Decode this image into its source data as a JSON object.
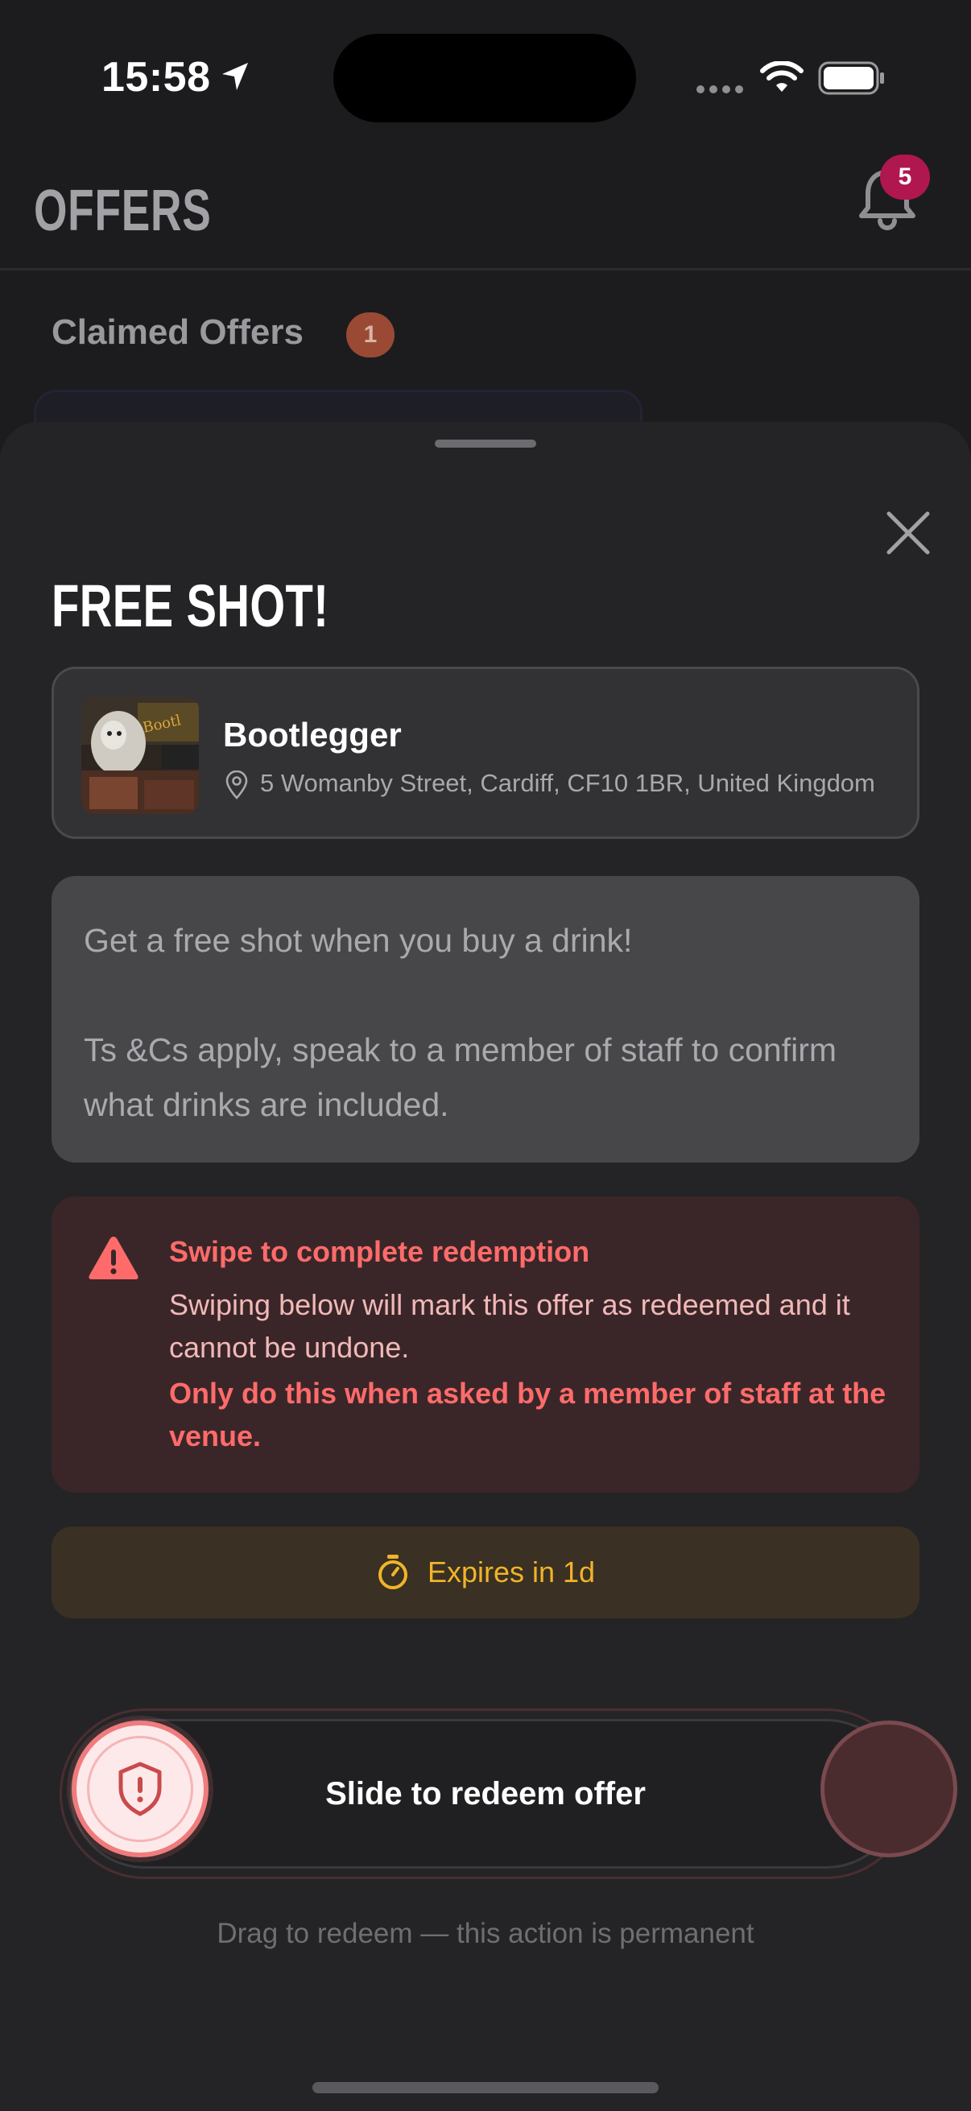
{
  "status_bar": {
    "time": "15:58"
  },
  "header": {
    "title": "OFFERS",
    "notification_count": "5"
  },
  "claimed": {
    "title": "Claimed Offers",
    "count": "1"
  },
  "sheet": {
    "offer_title": "FREE SHOT!",
    "venue": {
      "name": "Bootlegger",
      "address": "5 Womanby Street, Cardiff, CF10 1BR, United Kingdom"
    },
    "description": "Get a free shot when you buy a drink!\n\nTs &Cs apply, speak to a member of staff to confirm what drinks are included.",
    "warning": {
      "title": "Swipe to complete redemption",
      "body": "Swiping below will mark this offer as redeemed and it cannot be undone.",
      "emphasis": "Only do this when asked by a member of staff at the venue."
    },
    "expires": "Expires in 1d",
    "slider_label": "Slide to redeem offer",
    "drag_hint": "Drag to redeem — this action is permanent"
  },
  "colors": {
    "background": "#1c1c1e",
    "sheet": "#242426",
    "warning_red": "#ff6b6b",
    "expires_amber": "#f0b429",
    "badge": "#b0174f"
  },
  "icons": [
    "location-arrow-icon",
    "wifi-icon",
    "battery-icon",
    "bell-icon",
    "close-icon",
    "map-pin-icon",
    "warning-triangle-icon",
    "timer-icon",
    "shield-alert-icon"
  ]
}
